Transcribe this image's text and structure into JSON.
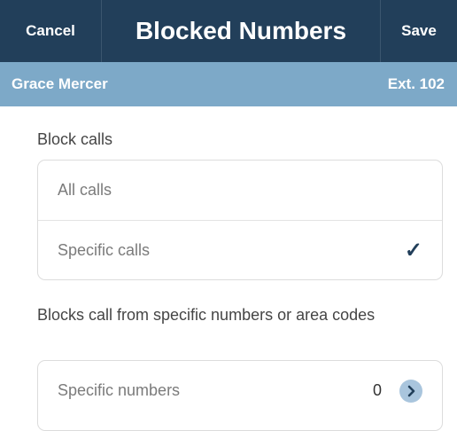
{
  "header": {
    "cancel_label": "Cancel",
    "title": "Blocked Numbers",
    "save_label": "Save"
  },
  "user": {
    "name": "Grace Mercer",
    "extension": "Ext. 102"
  },
  "block_calls": {
    "heading": "Block calls",
    "options": [
      {
        "label": "All calls",
        "selected": false
      },
      {
        "label": "Specific calls",
        "selected": true
      }
    ],
    "check_icon": "✓"
  },
  "specific": {
    "description": "Blocks call from specific numbers or area codes",
    "row_label": "Specific numbers",
    "count": "0",
    "chevron_icon": "chevron-right-circle"
  },
  "colors": {
    "navbar": "#223f5a",
    "userbar": "#7da9c8",
    "accent": "#223f5a"
  }
}
